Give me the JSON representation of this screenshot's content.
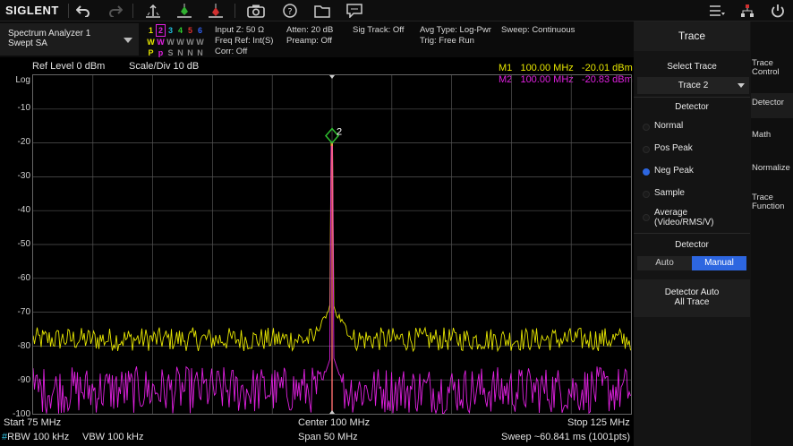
{
  "toolbar": {
    "logo": "SIGLENT",
    "icons": [
      "undo-icon",
      "redo-icon",
      "peak-search-icon",
      "marker-icon",
      "marker-to-icon",
      "screenshot-icon",
      "help-icon",
      "folder-icon",
      "message-icon",
      "menu-icon",
      "network-icon",
      "power-icon"
    ]
  },
  "mode": {
    "line1": "Spectrum Analyzer 1",
    "line2": "Swept SA"
  },
  "traces": {
    "numbers": [
      "1",
      "2",
      "3",
      "4",
      "5",
      "6"
    ],
    "types": [
      "W",
      "W",
      "W",
      "W",
      "W",
      "W"
    ],
    "detectors": [
      "P",
      "p",
      "S",
      "N",
      "N",
      "N"
    ],
    "colors": [
      "#e6e600",
      "#e020e0",
      "#20c0e0",
      "#30d030",
      "#e03030",
      "#3060f0"
    ]
  },
  "info": {
    "input": "Input Z: 50 Ω",
    "freqref": "Freq Ref: Int(S)",
    "corr": "Corr: Off",
    "atten": "Atten: 20 dB",
    "preamp": "Preamp: Off",
    "sigtrack": "Sig Track: Off",
    "avgtype": "Avg Type: Log-Pwr",
    "trig": "Trig: Free Run",
    "sweep": "Sweep: Continuous"
  },
  "plot": {
    "ref_level": "Ref Level  0 dBm",
    "scale": "Scale/Div  10 dB",
    "log_label": "Log",
    "y_ticks": [
      "-10",
      "-20",
      "-30",
      "-40",
      "-50",
      "-60",
      "-70",
      "-80",
      "-90",
      "-100"
    ],
    "marker1": "M1   100.00 MHz   -20.01 dBm",
    "marker2": "M2   100.00 MHz   -20.83 dBm",
    "marker_label": "2",
    "start": "Start  75 MHz",
    "center": "Center  100 MHz",
    "stop": "Stop  125 MHz",
    "rbw_prefix": "#",
    "rbw": "RBW  100 kHz",
    "vbw": "VBW  100 kHz",
    "span": "Span  50 MHz",
    "sweep_time": "Sweep  ~60.841 ms (1001pts)"
  },
  "panel": {
    "title": "Trace",
    "select_trace_label": "Select Trace",
    "select_trace_value": "Trace 2",
    "detector_label": "Detector",
    "detectors": [
      "Normal",
      "Pos Peak",
      "Neg Peak",
      "Sample",
      "Average\n(Video/RMS/V)"
    ],
    "selected_detector": "Neg Peak",
    "detector_mode_label": "Detector",
    "auto": "Auto",
    "manual": "Manual",
    "detector_auto_line1": "Detector Auto",
    "detector_auto_line2": "All Trace",
    "side_tabs": [
      "Trace\nControl",
      "Detector",
      "Math",
      "Normalize",
      "Trace\nFunction"
    ],
    "active_tab": "Detector"
  }
}
